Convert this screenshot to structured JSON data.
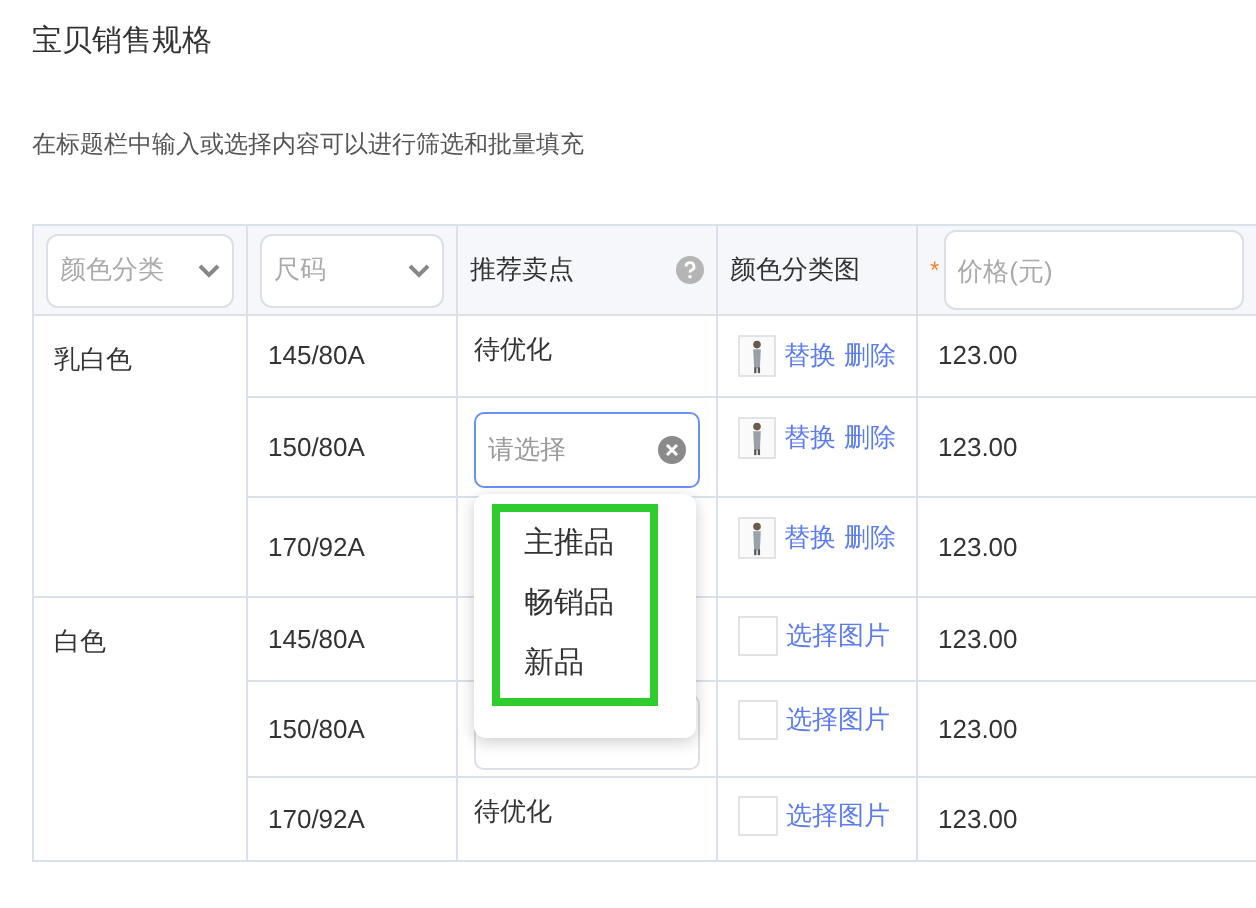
{
  "title": "宝贝销售规格",
  "hint": "在标题栏中输入或选择内容可以进行筛选和批量填充",
  "columns": [
    {
      "kind": "select",
      "label": "颜色分类"
    },
    {
      "kind": "select",
      "label": "尺码"
    },
    {
      "kind": "text",
      "label": "推荐卖点",
      "help": true
    },
    {
      "kind": "text",
      "label": "颜色分类图"
    },
    {
      "kind": "input",
      "placeholder": "价格(元)",
      "required_mark": "*"
    }
  ],
  "groups": [
    {
      "name": "乳白色",
      "rows": [
        {
          "size": "145/80A",
          "recommend": {
            "kind": "text",
            "value": "待优化"
          },
          "image": {
            "kind": "thumb",
            "actions": [
              "替换",
              "删除"
            ]
          },
          "price": "123.00"
        },
        {
          "size": "150/80A",
          "recommend": {
            "kind": "select",
            "placeholder": "请选择",
            "open": true
          },
          "image": {
            "kind": "thumb",
            "actions": [
              "替换",
              "删除"
            ]
          },
          "price": "123.00"
        },
        {
          "size": "170/92A",
          "recommend": {
            "kind": "none"
          },
          "image": {
            "kind": "thumb",
            "actions": [
              "替换",
              "删除"
            ]
          },
          "price": "123.00"
        }
      ]
    },
    {
      "name": "白色",
      "rows": [
        {
          "size": "145/80A",
          "recommend": {
            "kind": "none"
          },
          "image": {
            "kind": "empty",
            "actions": [
              "选择图片"
            ]
          },
          "price": "123.00"
        },
        {
          "size": "150/80A",
          "recommend": {
            "kind": "covered"
          },
          "image": {
            "kind": "empty",
            "actions": [
              "选择图片"
            ]
          },
          "price": "123.00"
        },
        {
          "size": "170/92A",
          "recommend": {
            "kind": "text",
            "value": "待优化"
          },
          "image": {
            "kind": "empty",
            "actions": [
              "选择图片"
            ]
          },
          "price": "123.00"
        }
      ]
    }
  ],
  "dropdown": {
    "options": [
      "主推品",
      "畅销品",
      "新品"
    ],
    "highlighted": true
  }
}
